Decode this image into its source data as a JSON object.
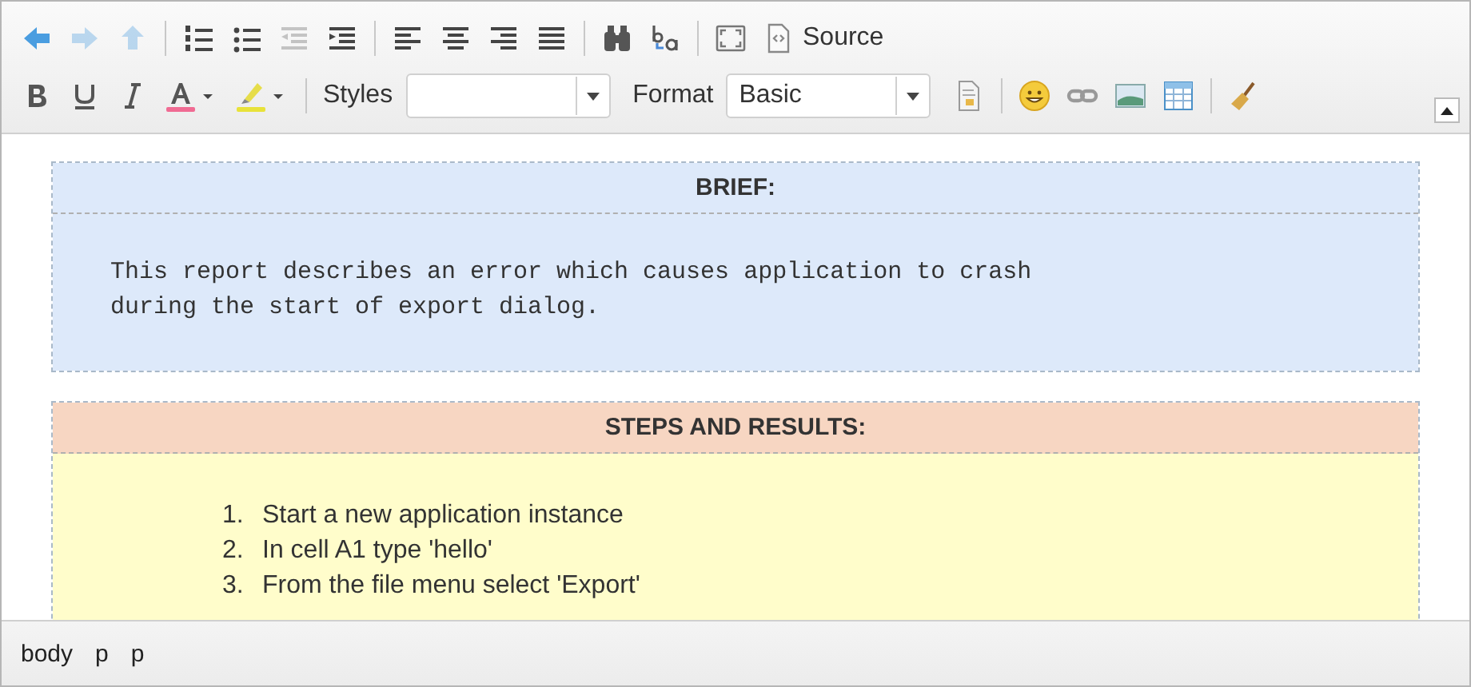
{
  "toolbar_rows": [
    [
      {
        "kind": "undo",
        "disabled": false
      },
      {
        "kind": "redo",
        "disabled": true
      },
      {
        "kind": "anchor",
        "disabled": true
      },
      {
        "kind": "sep"
      },
      {
        "kind": "numbered",
        "disabled": false
      },
      {
        "kind": "bulleted",
        "disabled": false
      },
      {
        "kind": "outdent",
        "disabled": true
      },
      {
        "kind": "indent",
        "disabled": false
      },
      {
        "kind": "sep"
      },
      {
        "kind": "align-left",
        "disabled": false
      },
      {
        "kind": "align-center",
        "disabled": false
      },
      {
        "kind": "align-right",
        "disabled": false
      },
      {
        "kind": "justify",
        "disabled": false
      },
      {
        "kind": "sep"
      },
      {
        "kind": "find",
        "disabled": false
      },
      {
        "kind": "replace",
        "disabled": false
      },
      {
        "kind": "sep"
      },
      {
        "kind": "maximize",
        "disabled": false
      },
      {
        "kind": "source",
        "label": "Source",
        "disabled": false
      }
    ],
    [
      {
        "kind": "bold",
        "disabled": false
      },
      {
        "kind": "underline",
        "disabled": false
      },
      {
        "kind": "italic",
        "disabled": false
      },
      {
        "kind": "text-color",
        "disabled": false
      },
      {
        "kind": "bg-color",
        "disabled": false
      },
      {
        "kind": "sep"
      },
      {
        "kind": "combo",
        "label": "Styles"
      },
      {
        "kind": "combo",
        "label": "Format",
        "value": "Basic"
      },
      {
        "kind": "templates",
        "disabled": false
      },
      {
        "kind": "sep"
      },
      {
        "kind": "smiley",
        "disabled": false
      },
      {
        "kind": "link",
        "disabled": false
      },
      {
        "kind": "image",
        "disabled": false
      },
      {
        "kind": "table",
        "disabled": false
      },
      {
        "kind": "sep"
      },
      {
        "kind": "clean",
        "disabled": false
      }
    ]
  ],
  "sections": [
    {
      "kind": "brief",
      "heading": "BRIEF:",
      "text": "This report describes an error which causes application to crash\nduring the start of export dialog."
    },
    {
      "kind": "steps",
      "heading": "STEPS AND RESULTS:",
      "steps": [
        {
          "number": "1.",
          "text": "Start a new application instance"
        },
        {
          "number": "2.",
          "text": "In cell A1 type 'hello'"
        },
        {
          "number": "3.",
          "text": "From the file menu select 'Export'"
        }
      ]
    }
  ],
  "status_path": [
    "body",
    "p",
    "p"
  ]
}
